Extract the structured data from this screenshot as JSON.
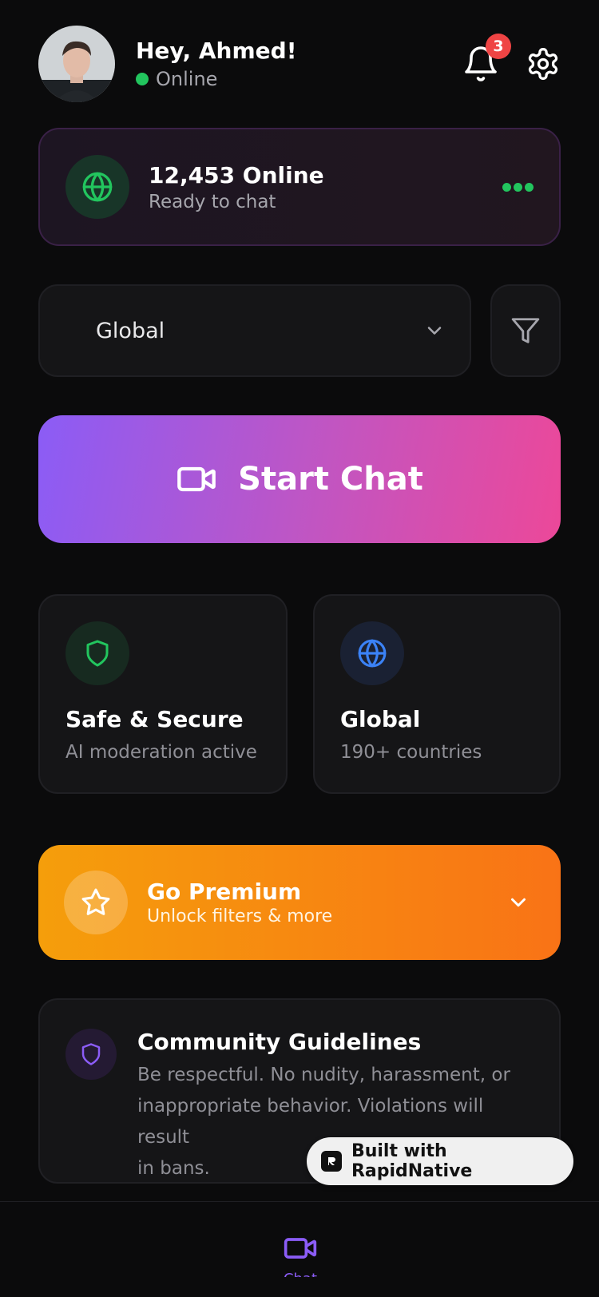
{
  "header": {
    "greeting": "Hey, Ahmed!",
    "status": "Online",
    "notification_count": "3",
    "status_color": "#22c55e"
  },
  "online_card": {
    "count": "12,453 Online",
    "subtitle": "Ready to chat"
  },
  "region": {
    "selected": "Global",
    "icon": "chevron-down-icon",
    "filter_icon": "filter-icon"
  },
  "start_chat": {
    "label": "Start Chat",
    "icon": "video-icon",
    "gradient": [
      "#8b5cf6",
      "#ec4899"
    ]
  },
  "features": [
    {
      "title": "Safe & Secure",
      "subtitle": "AI moderation active",
      "icon": "shield-icon",
      "color": "#22c55e"
    },
    {
      "title": "Global",
      "subtitle": "190+ countries",
      "icon": "globe-icon",
      "color": "#3b82f6"
    }
  ],
  "premium": {
    "title": "Go Premium",
    "subtitle": "Unlock filters & more",
    "icon": "star-icon",
    "gradient": [
      "#f59e0b",
      "#f97316"
    ]
  },
  "guidelines": {
    "title": "Community Guidelines",
    "body_line1": "Be respectful. No nudity, harassment, or",
    "body_line2": "inappropriate behavior. Violations will result",
    "body_line3": "in bans.",
    "icon": "shield-icon"
  },
  "built_with": {
    "label": "Built with RapidNative"
  },
  "tabbar": {
    "active_label": "Chat",
    "active_icon": "video-icon",
    "accent": "#8b5cf6"
  }
}
